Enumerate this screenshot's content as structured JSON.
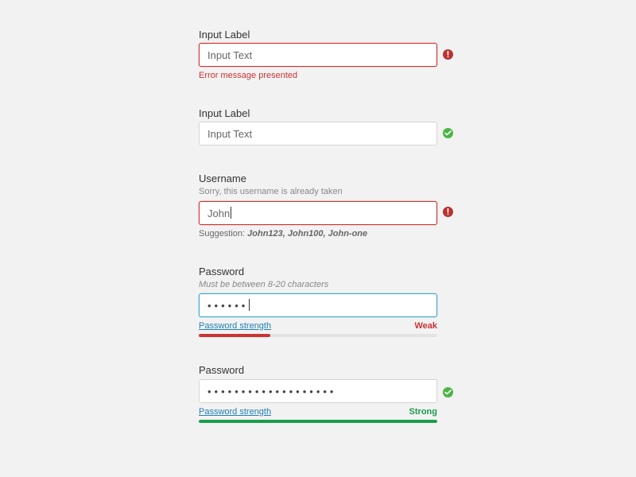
{
  "field1": {
    "label": "Input Label",
    "value": "Input Text",
    "error": "Error message presented"
  },
  "field2": {
    "label": "Input Label",
    "value": "Input Text"
  },
  "username": {
    "label": "Username",
    "hint": "Sorry, this username is already taken",
    "value": "John",
    "suggestion_prefix": "Suggestion: ",
    "suggestion_names": "John123, John100, John-one"
  },
  "password1": {
    "label": "Password",
    "hint": "Must be between 8-20 characters",
    "dots": "••••••",
    "strength_link": "Password strength",
    "strength_label": "Weak"
  },
  "password2": {
    "label": "Password",
    "dots": "•••••••••••••••••••",
    "strength_link": "Password strength",
    "strength_label": "Strong"
  }
}
